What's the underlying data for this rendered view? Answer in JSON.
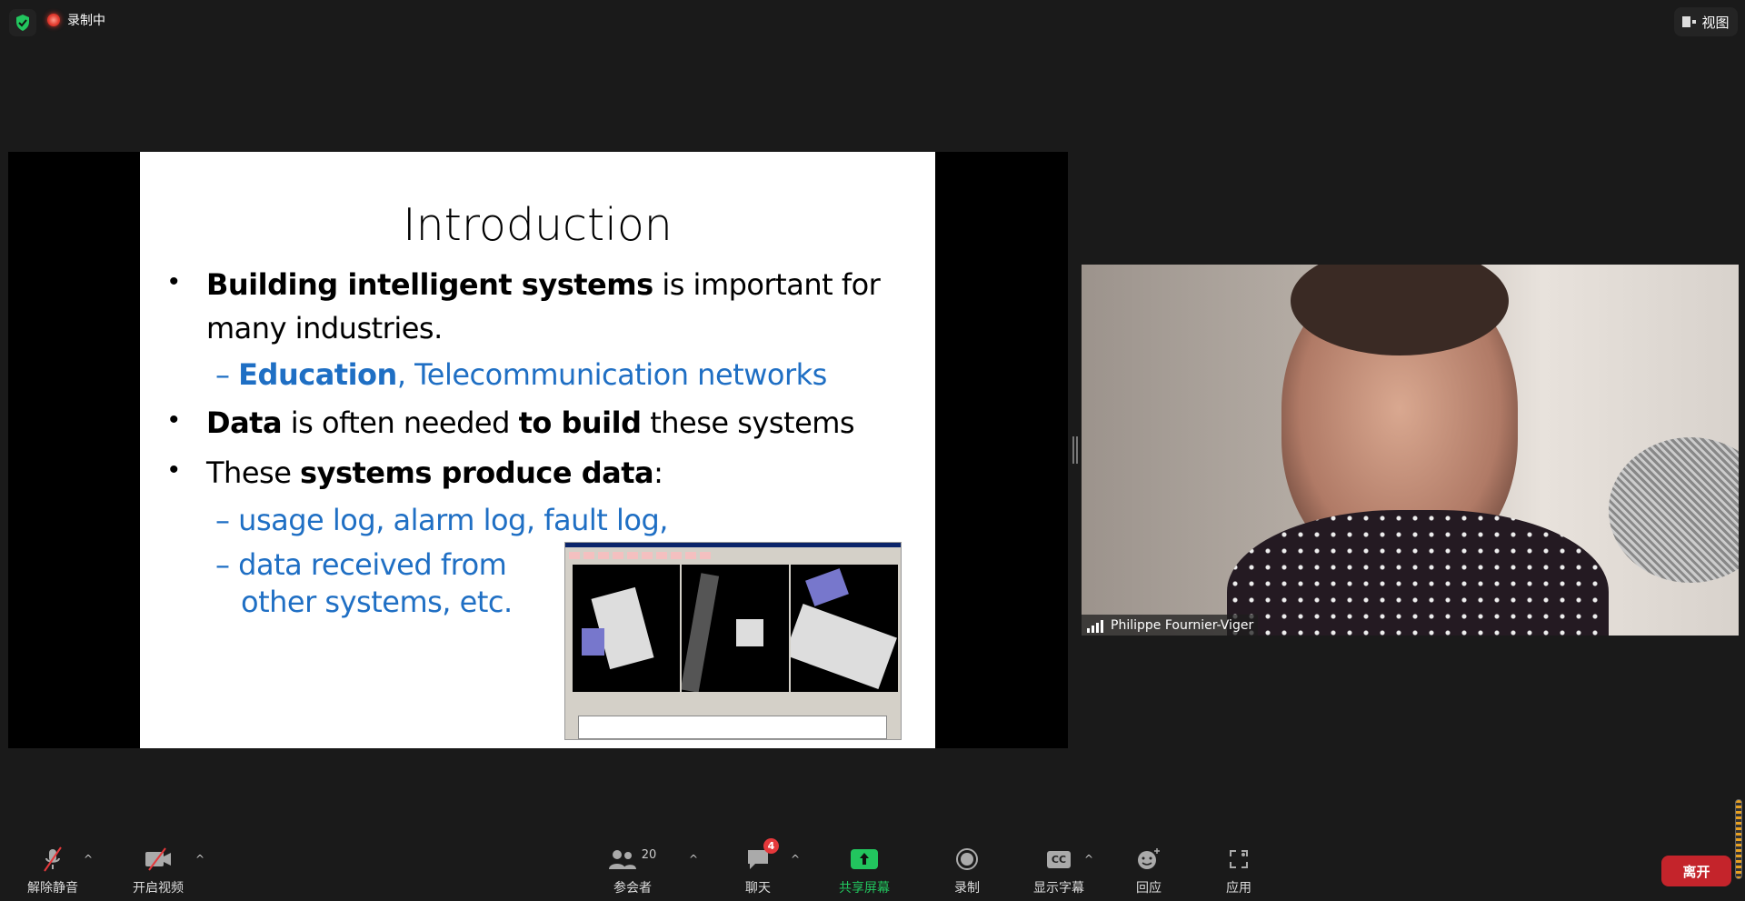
{
  "top": {
    "recording_label": "录制中",
    "view_label": "视图",
    "shield_color": "#22c55e"
  },
  "slide": {
    "title": "Introduction",
    "bullets": [
      {
        "bold": "Building intelligent systems",
        "rest": " is important for",
        "cont": "many industries."
      },
      {
        "sub_bold": "Education",
        "sub_rest": ", Telecommunication networks"
      },
      {
        "b1": "Data",
        "m": " is often needed ",
        "b2": "to build",
        "rest": " these systems"
      },
      {
        "pre": "These ",
        "bold": "systems produce data",
        "rest": ":"
      },
      {
        "sub": "usage log, alarm log, fault log,"
      },
      {
        "sub": "data received from",
        "cont": "other systems, etc."
      }
    ],
    "bullet_glyph": "•",
    "dash_glyph": "–",
    "accent": "#1f6fc4"
  },
  "video": {
    "participant_name": "Philippe Fournier-Viger"
  },
  "toolbar": {
    "mute": "解除静音",
    "video": "开启视频",
    "participants": "参会者",
    "participant_count": "20",
    "chat": "聊天",
    "chat_badge": "4",
    "share": "共享屏幕",
    "record": "录制",
    "captions": "显示字幕",
    "captions_icon": "CC",
    "reactions": "回应",
    "apps": "应用",
    "leave": "离开",
    "share_color": "#22c55e",
    "leave_color": "#c4242b"
  }
}
